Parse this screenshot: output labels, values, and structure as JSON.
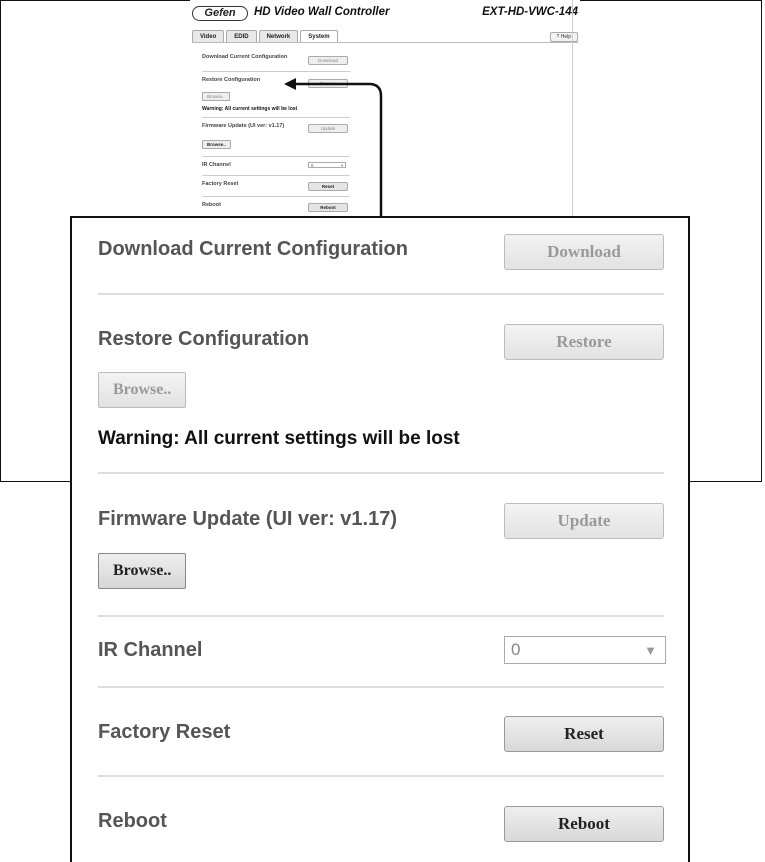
{
  "app": {
    "logo_text": "Gefen",
    "title": "HD Video Wall Controller",
    "model": "EXT-HD-VWC-144",
    "help_label": "? Help"
  },
  "tabs": [
    {
      "label": "Video",
      "active": false
    },
    {
      "label": "EDID",
      "active": false
    },
    {
      "label": "Network",
      "active": false
    },
    {
      "label": "System",
      "active": true
    }
  ],
  "system": {
    "download": {
      "label": "Download Current Configuration",
      "button": "Download"
    },
    "restore": {
      "label": "Restore Configuration",
      "button": "Restore",
      "browse": "Browse..",
      "warning": "Warning: All current settings will be lost"
    },
    "firmware": {
      "label": "Firmware Update (UI ver: v1.17)",
      "button": "Update",
      "browse": "Browse.."
    },
    "ir": {
      "label": "IR Channel",
      "value": "0"
    },
    "factory": {
      "label": "Factory Reset",
      "button": "Reset"
    },
    "reboot": {
      "label": "Reboot",
      "button": "Reboot"
    }
  },
  "colors": {
    "disabled_text": "#999999",
    "enabled_text": "#222222",
    "label_text": "#555555"
  }
}
